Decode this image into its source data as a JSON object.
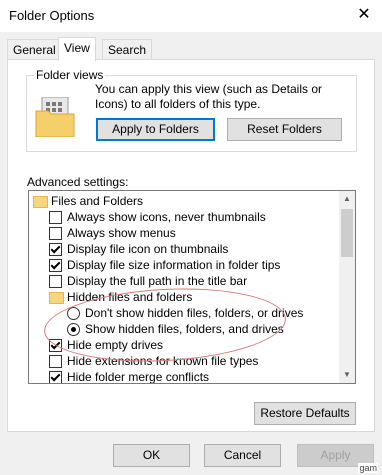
{
  "window": {
    "title": "Folder Options",
    "close_glyph": "✕"
  },
  "tabs": [
    {
      "label": "General"
    },
    {
      "label": "View"
    },
    {
      "label": "Search"
    }
  ],
  "folder_views": {
    "legend": "Folder views",
    "description": "You can apply this view (such as Details or Icons) to all folders of this type.",
    "apply_button": "Apply to Folders",
    "reset_button": "Reset Folders"
  },
  "advanced": {
    "label": "Advanced settings:",
    "items": [
      {
        "text": "Files and Folders",
        "kind": "folder"
      },
      {
        "text": "Always show icons, never thumbnails",
        "kind": "checkbox",
        "checked": false
      },
      {
        "text": "Always show menus",
        "kind": "checkbox",
        "checked": false
      },
      {
        "text": "Display file icon on thumbnails",
        "kind": "checkbox",
        "checked": true
      },
      {
        "text": "Display file size information in folder tips",
        "kind": "checkbox",
        "checked": true
      },
      {
        "text": "Display the full path in the title bar",
        "kind": "checkbox",
        "checked": false
      },
      {
        "text": "Hidden files and folders",
        "kind": "folder"
      },
      {
        "text": "Don't show hidden files, folders, or drives",
        "kind": "radio",
        "checked": false
      },
      {
        "text": "Show hidden files, folders, and drives",
        "kind": "radio",
        "checked": true
      },
      {
        "text": "Hide empty drives",
        "kind": "checkbox",
        "checked": true
      },
      {
        "text": "Hide extensions for known file types",
        "kind": "checkbox",
        "checked": false
      },
      {
        "text": "Hide folder merge conflicts",
        "kind": "checkbox",
        "checked": true
      }
    ]
  },
  "restore_defaults": "Restore Defaults",
  "buttons": {
    "ok": "OK",
    "cancel": "Cancel",
    "apply": "Apply"
  },
  "watermark": "gam"
}
